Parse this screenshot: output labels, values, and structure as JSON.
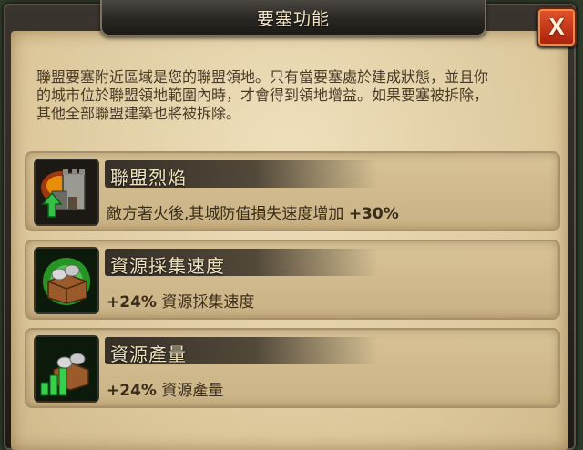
{
  "dialog": {
    "title": "要塞功能",
    "close_label": "X"
  },
  "description": "聯盟要塞附近區域是您的聯盟領地。只有當要塞處於建成狀態，並且你\n的城市位於聯盟領地範圍內時，才會得到領地增益。如果要塞被拆除，\n其他全部聯盟建築也將被拆除。",
  "features": [
    {
      "icon": "burning-fortress-icon",
      "name": "聯盟烈焰",
      "desc_prefix": "敵方著火後,其城防值損失速度增加 ",
      "desc_value": "+30%",
      "desc_suffix": ""
    },
    {
      "icon": "resource-crate-icon",
      "name": "資源採集速度",
      "desc_prefix": "",
      "desc_value": "+24%",
      "desc_suffix": " 資源採集速度"
    },
    {
      "icon": "resource-production-icon",
      "name": "資源產量",
      "desc_prefix": "",
      "desc_value": "+24%",
      "desc_suffix": " 資源產量"
    }
  ]
}
